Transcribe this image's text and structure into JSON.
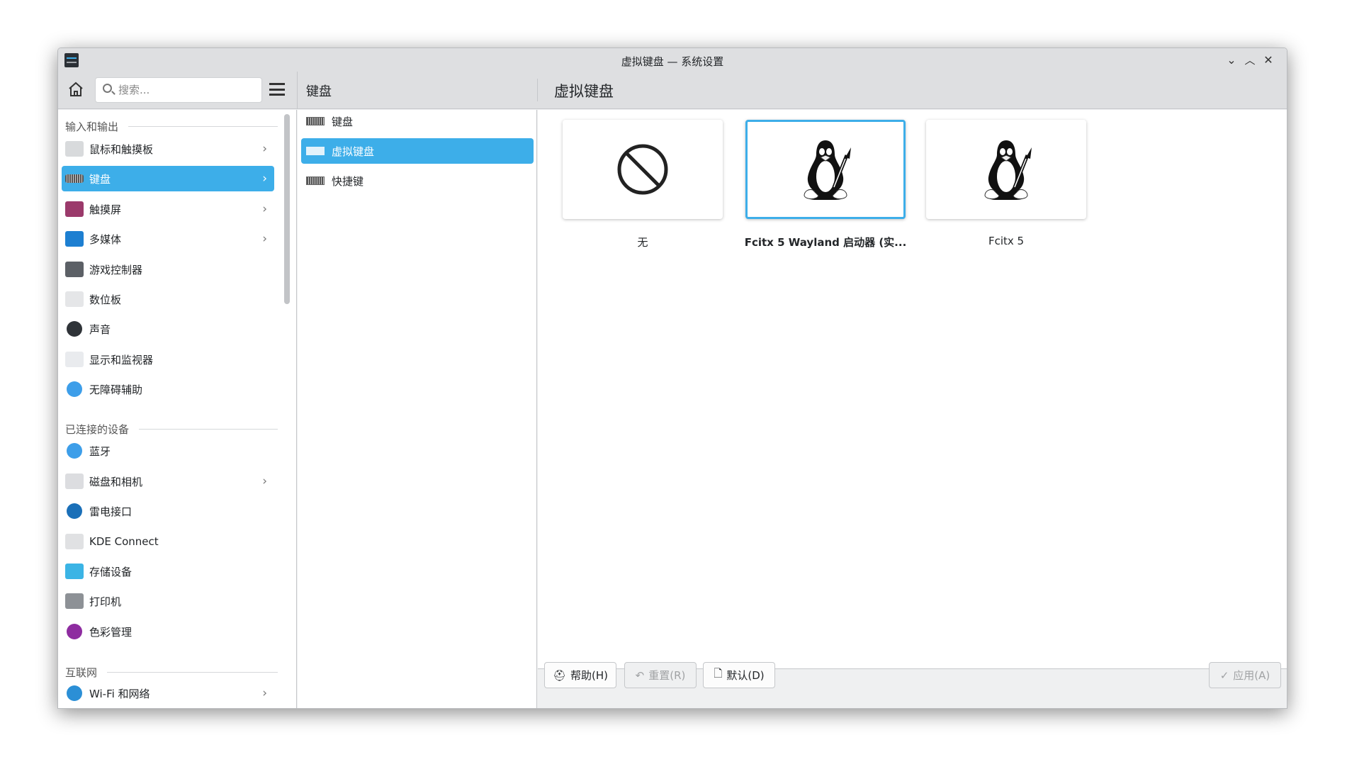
{
  "window": {
    "title": "虚拟键盘 — 系统设置"
  },
  "toolbar": {
    "search_placeholder": "搜索...",
    "mid_title": "键盘",
    "content_title": "虚拟键盘"
  },
  "sidebar": {
    "sections": [
      {
        "label": "输入和输出",
        "items": [
          {
            "label": "鼠标和触摸板",
            "icon": "mouse-icon",
            "chevron": true
          },
          {
            "label": "键盘",
            "icon": "keyboard-icon",
            "chevron": true,
            "selected": true
          },
          {
            "label": "触摸屏",
            "icon": "touchscreen-icon",
            "chevron": true
          },
          {
            "label": "多媒体",
            "icon": "multimedia-icon",
            "chevron": true
          },
          {
            "label": "游戏控制器",
            "icon": "gamepad-icon"
          },
          {
            "label": "数位板",
            "icon": "tablet-icon"
          },
          {
            "label": "声音",
            "icon": "speaker-icon"
          },
          {
            "label": "显示和监视器",
            "icon": "monitor-icon"
          },
          {
            "label": "无障碍辅助",
            "icon": "accessibility-icon"
          }
        ]
      },
      {
        "label": "已连接的设备",
        "items": [
          {
            "label": "蓝牙",
            "icon": "bluetooth-icon"
          },
          {
            "label": "磁盘和相机",
            "icon": "disk-icon",
            "chevron": true
          },
          {
            "label": "雷电接口",
            "icon": "thunderbolt-icon"
          },
          {
            "label": "KDE Connect",
            "icon": "phone-icon"
          },
          {
            "label": "存储设备",
            "icon": "storage-icon"
          },
          {
            "label": "打印机",
            "icon": "printer-icon"
          },
          {
            "label": "色彩管理",
            "icon": "color-icon"
          }
        ]
      },
      {
        "label": "互联网",
        "items": [
          {
            "label": "Wi-Fi 和网络",
            "icon": "globe-icon",
            "chevron": true
          }
        ]
      }
    ]
  },
  "middle": {
    "items": [
      {
        "label": "键盘"
      },
      {
        "label": "虚拟键盘",
        "selected": true
      },
      {
        "label": "快捷键"
      }
    ]
  },
  "content": {
    "options": [
      {
        "label": "无",
        "icon": "none-icon"
      },
      {
        "label": "Fcitx 5 Wayland 启动器 (实...",
        "icon": "tux-icon",
        "selected": true
      },
      {
        "label": "Fcitx 5",
        "icon": "tux-icon"
      }
    ]
  },
  "footer": {
    "help": "帮助(H)",
    "reset": "重置(R)",
    "defaults": "默认(D)",
    "apply": "应用(A)"
  },
  "colors": {
    "accent": "#3daee9"
  }
}
